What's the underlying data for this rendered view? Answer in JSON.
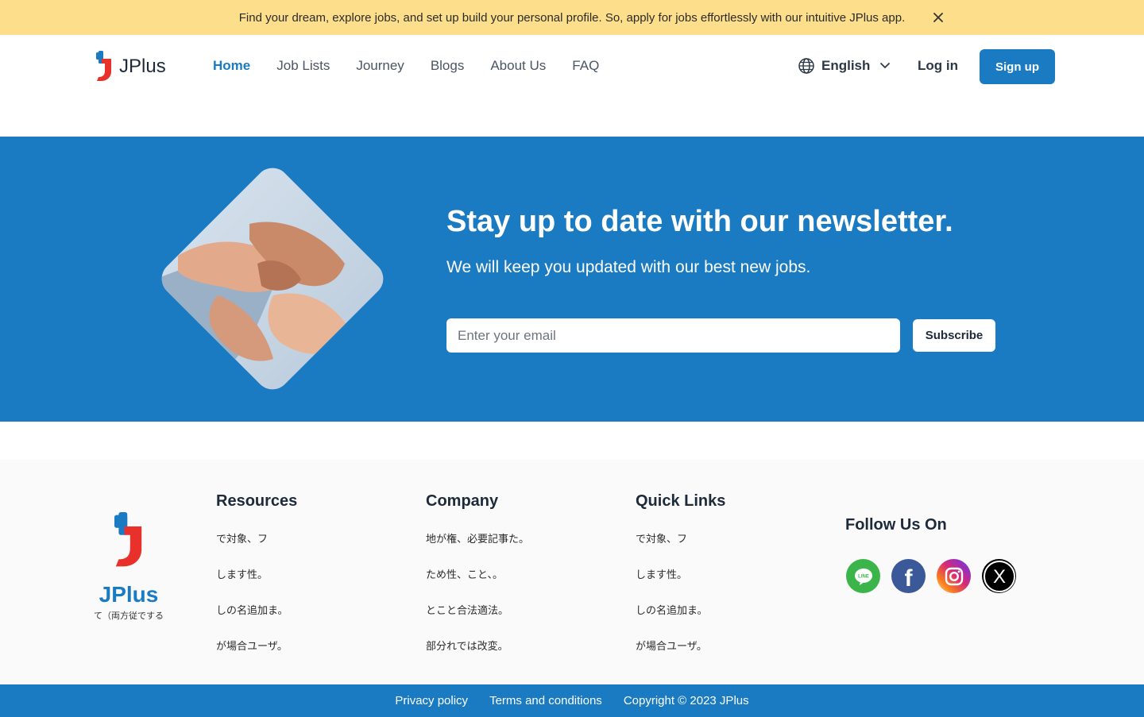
{
  "announcement": {
    "text": "Find your dream, explore jobs, and set up build your personal profile. So, apply for jobs effortlessly with our intuitive JPlus app."
  },
  "header": {
    "logo_text": "JPlus",
    "nav": [
      "Home",
      "Job Lists",
      "Journey",
      "Blogs",
      "About  Us",
      "FAQ"
    ],
    "active_nav": "Home",
    "language": "English",
    "login_label": "Log in",
    "signup_label": "Sign up"
  },
  "newsletter": {
    "title": "Stay up to date with our newsletter.",
    "subtitle": "We will keep you updated with our best new jobs.",
    "email_placeholder": "Enter your email",
    "subscribe_label": "Subscribe"
  },
  "footer": {
    "logo_name": "JPlus",
    "tagline": "て（両方従でする",
    "columns": [
      {
        "title": "Resources",
        "links": [
          "で対象、フ",
          "します性。",
          "しの名追加ま。",
          "が場合ユーザ。"
        ]
      },
      {
        "title": "Company",
        "links": [
          "地が権、必要記事た。",
          "ため性、こと、。",
          "とこと合法適法。",
          "部分れでは改変。"
        ]
      },
      {
        "title": "Quick Links",
        "links": [
          "で対象、フ",
          "します性。",
          "しの名追加ま。",
          "が場合ユーザ。"
        ]
      }
    ],
    "follow_title": "Follow Us On",
    "socials": [
      {
        "icon": "line-icon",
        "label": "LINE",
        "color": "#3bb54a"
      },
      {
        "icon": "facebook-icon",
        "label": "f",
        "color": "#3b5998"
      },
      {
        "icon": "instagram-icon",
        "label": "",
        "color": "#d6249f"
      },
      {
        "icon": "x-icon",
        "label": "X",
        "color": "#000000"
      }
    ]
  },
  "bottom_bar": {
    "privacy": "Privacy policy",
    "terms": "Terms and conditions",
    "copyright": "Copyright © 2023 JPlus"
  },
  "colors": {
    "brand_blue": "#1a7bc2",
    "announcement_bg": "#fcde8b",
    "logo_red": "#e8312a"
  }
}
